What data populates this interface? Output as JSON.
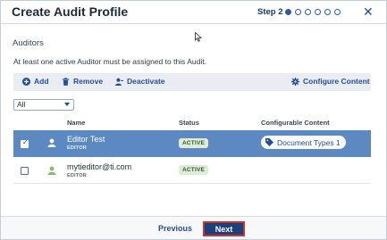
{
  "dialog": {
    "title": "Create Audit Profile",
    "step_label": "Step 2",
    "steps": [
      "active",
      "",
      "",
      "",
      "",
      ""
    ],
    "close_label": "✕"
  },
  "section": {
    "title": "Auditors",
    "help_text": "At least one active Auditor must be assigned to this Audit."
  },
  "toolbar": {
    "add_label": "Add",
    "remove_label": "Remove",
    "deactivate_label": "Deactivate",
    "configure_label": "Configure Content"
  },
  "filter": {
    "selected": "All"
  },
  "table": {
    "headers": {
      "name": "Name",
      "status": "Status",
      "configurable": "Configurable Content"
    },
    "rows": [
      {
        "name": "Editor Test",
        "role": "EDITOR",
        "status": "ACTIVE",
        "content": "Document Types 1",
        "selected": true
      },
      {
        "name": "mytieditor@ti.com",
        "role": "EDITOR",
        "status": "ACTIVE",
        "content": "",
        "selected": false
      }
    ]
  },
  "footer": {
    "previous_label": "Previous",
    "next_label": "Next"
  },
  "colors": {
    "accent": "#1d3f7b",
    "selected_row": "#5d89c3",
    "active_badge": "#dfead7",
    "next_highlight": "#c0392b"
  }
}
